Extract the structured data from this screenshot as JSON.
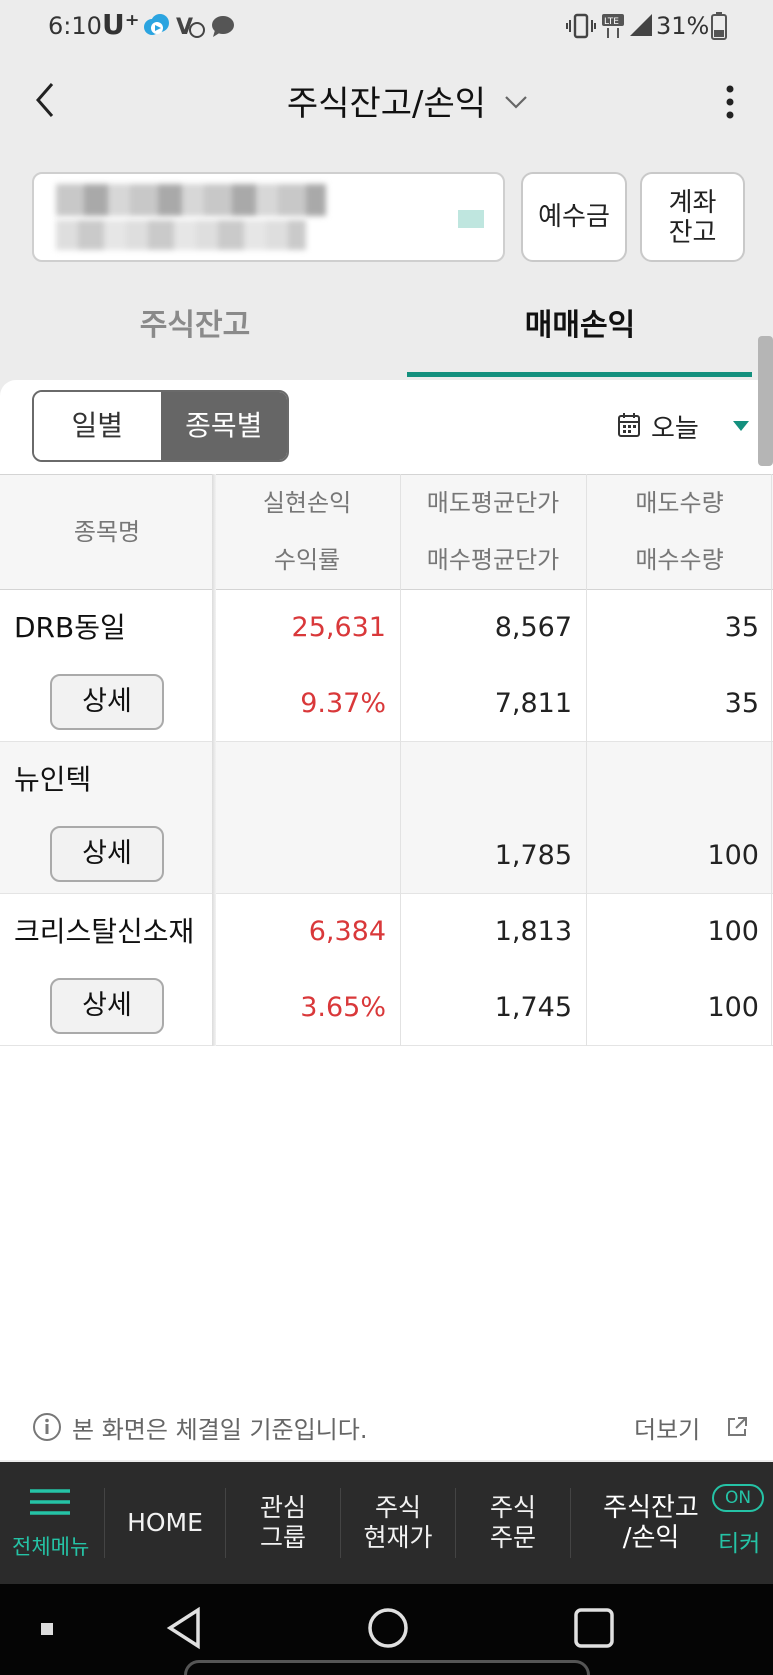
{
  "status_bar": {
    "time": "6:10",
    "carrier": "U⁺",
    "battery": "31%"
  },
  "header": {
    "title": "주식잔고/손익"
  },
  "account": {
    "deposit_button": "예수금",
    "account_balance_line1": "계좌",
    "account_balance_line2": "잔고"
  },
  "tabs": [
    {
      "label": "주식잔고",
      "active": false
    },
    {
      "label": "매매손익",
      "active": true
    }
  ],
  "segment": {
    "daily": "일별",
    "by_stock": "종목별",
    "selected": "종목별"
  },
  "date_filter": {
    "value": "오늘"
  },
  "table": {
    "headers": {
      "name": "종목명",
      "realized_pl": "실현손익",
      "return_rate": "수익률",
      "avg_sell_price": "매도평균단가",
      "avg_buy_price": "매수평균단가",
      "sell_qty": "매도수량",
      "buy_qty": "매수수량"
    },
    "detail_label": "상세",
    "rows": [
      {
        "name": "DRB동일",
        "realized_pl": "25,631",
        "return_rate": "9.37%",
        "avg_sell_price": "8,567",
        "avg_buy_price": "7,811",
        "sell_qty": "35",
        "buy_qty": "35"
      },
      {
        "name": "뉴인텍",
        "realized_pl": "",
        "return_rate": "",
        "avg_sell_price": "",
        "avg_buy_price": "1,785",
        "sell_qty": "",
        "buy_qty": "100"
      },
      {
        "name": "크리스탈신소재",
        "realized_pl": "6,384",
        "return_rate": "3.65%",
        "avg_sell_price": "1,813",
        "avg_buy_price": "1,745",
        "sell_qty": "100",
        "buy_qty": "100"
      }
    ]
  },
  "notice": {
    "text": "본 화면은 체결일 기준입니다.",
    "more": "더보기"
  },
  "bottom_nav": {
    "menu": "전체메뉴",
    "home": "HOME",
    "watch_line1": "관심",
    "watch_line2": "그룹",
    "price_line1": "주식",
    "price_line2": "현재가",
    "order_line1": "주식",
    "order_line2": "주문",
    "balance_line1": "주식잔고",
    "balance_line2": "/손익",
    "ticker_badge": "ON",
    "ticker_label": "티커"
  },
  "colors": {
    "accent": "#14907e",
    "profit": "#d9383a",
    "nav_accent": "#25c3a6"
  }
}
